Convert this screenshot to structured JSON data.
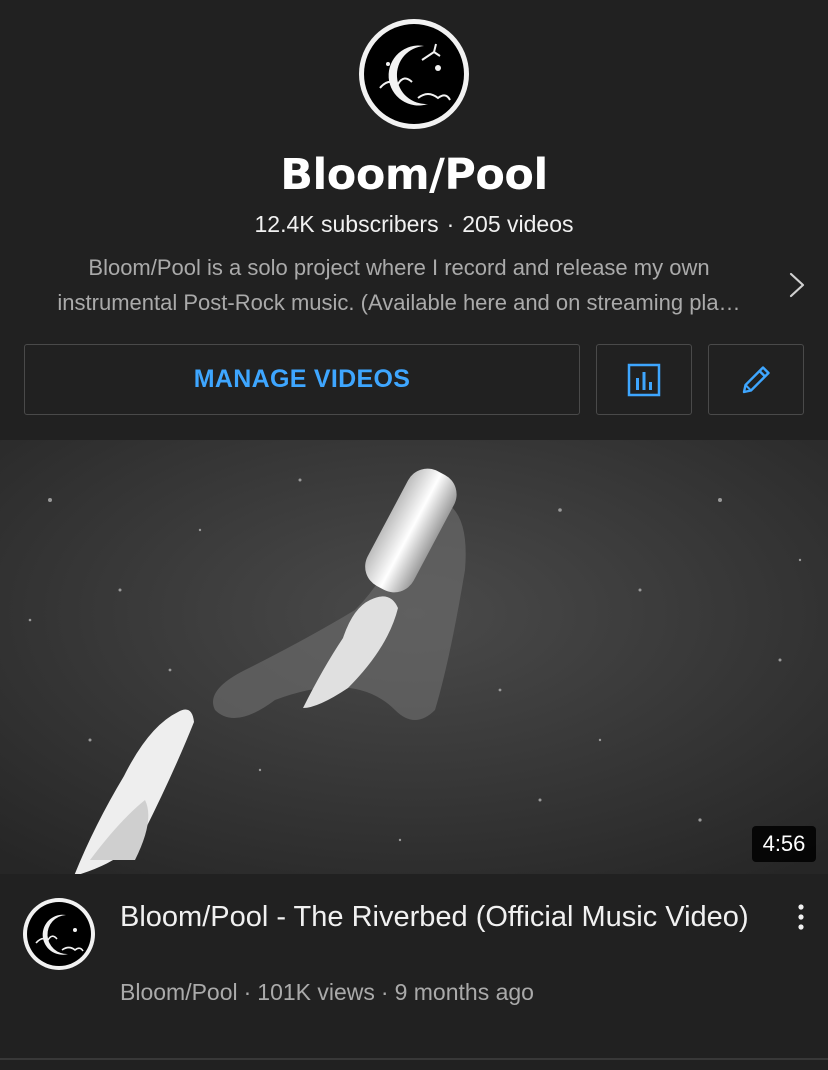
{
  "channel": {
    "name": "Bloom/Pool",
    "subscribers": "12.4K subscribers",
    "videos": "205 videos",
    "description_line1": "Bloom/Pool is a solo project where I record and release my own",
    "description_line2": "instrumental Post-Rock music. (Available here and on streaming pla…"
  },
  "actions": {
    "manage_videos": "MANAGE VIDEOS"
  },
  "video": {
    "duration": "4:56",
    "title": "Bloom/Pool - The Riverbed (Official Music Video)",
    "channel": "Bloom/Pool",
    "views": "101K views",
    "age": "9 months ago"
  },
  "colors": {
    "background": "#212121",
    "accent": "#3ea6ff",
    "secondary_text": "#aaaaaa"
  },
  "icons": {
    "analytics": "bar-chart-icon",
    "edit": "pencil-icon",
    "more": "more-vert-icon",
    "description_more": "chevron-right-icon"
  }
}
